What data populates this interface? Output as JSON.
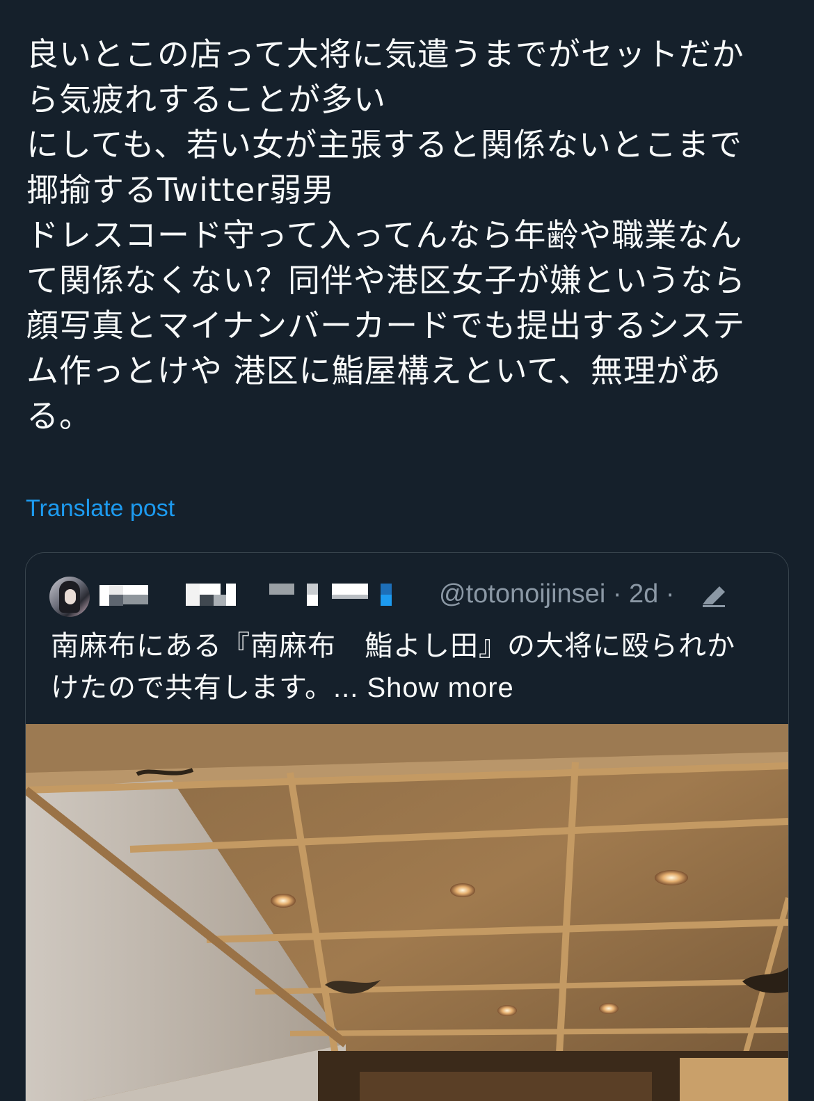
{
  "post": {
    "lines": [
      "良いとこの店って大将に気遣うまでがセットだか",
      "ら気疲れすることが多い",
      "にしても、若い女が主張すると関係ないとこまで",
      "揶揄するTwitter弱男",
      "ドレスコード守って入ってんなら年齢や職業なん",
      "て関係なくない？同伴や港区女子が嫌というなら",
      "顔写真とマイナンバーカードでも提出するシステ",
      "ム作っとけや 港区に鮨屋構えといて、無理があ",
      "る。"
    ],
    "translate_label": "Translate post"
  },
  "quote": {
    "handle_meta": "@totonoijinsei · 2d ·",
    "text_lines": [
      "南麻布にある『南麻布　鮨よし田』の大将に殴られか",
      "けたので共有します。"
    ],
    "show_more": "... Show more"
  },
  "colors": {
    "background": "#15202b",
    "text": "#f7f9f9",
    "link": "#1d9bf0",
    "muted": "#8b98a5",
    "border": "#38444d"
  },
  "icons": {
    "edit": "edit-pencil-icon"
  }
}
